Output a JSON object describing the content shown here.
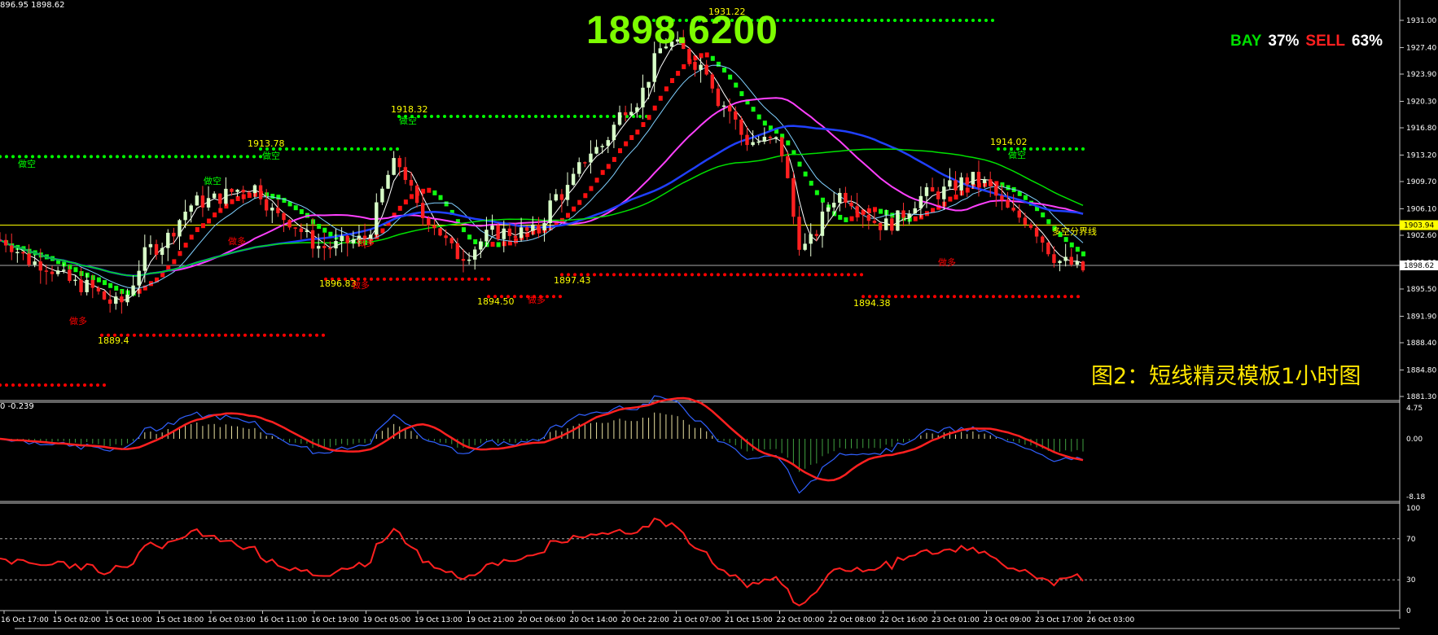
{
  "header": {
    "ohlc_text": "896.95 1898.62",
    "big_price": "1898.6200",
    "sentiment": {
      "buy_label": "BAY",
      "buy_pct": "37%",
      "sell_label": "SELL",
      "sell_pct": "63%"
    },
    "caption": "图2：短线精灵模板1小时图"
  },
  "colors": {
    "green": "#00FF00",
    "red": "#FF0000",
    "yellow": "#FFFF00",
    "buy": "#00E000",
    "sell": "#FF2020",
    "price_line": "#FFFF00"
  },
  "price_axis": {
    "labels": [
      "1931.00",
      "1927.40",
      "1923.90",
      "1920.30",
      "1916.80",
      "1913.20",
      "1909.70",
      "1906.10",
      "1902.60",
      "1899.00",
      "1895.50",
      "1891.90",
      "1888.40",
      "1884.80",
      "1881.30"
    ],
    "current_price": "1903.94",
    "bid_price": "1898.62"
  },
  "annotations": [
    {
      "text": "1931.22",
      "color": "yellow"
    },
    {
      "text": "1918.32",
      "color": "yellow"
    },
    {
      "text": "1913.78",
      "color": "yellow"
    },
    {
      "text": "1914.02",
      "color": "yellow"
    },
    {
      "text": "1896.83",
      "color": "yellow"
    },
    {
      "text": "1894.50",
      "color": "yellow"
    },
    {
      "text": "1897.43",
      "color": "yellow"
    },
    {
      "text": "1894.38",
      "color": "yellow"
    },
    {
      "text": "1889.4",
      "color": "yellow"
    },
    {
      "text": "做空",
      "color": "green"
    },
    {
      "text": "做多",
      "color": "red"
    },
    {
      "text": "做空",
      "color": "green"
    },
    {
      "text": "做多",
      "color": "red"
    },
    {
      "text": "做空",
      "color": "green"
    },
    {
      "text": "做多",
      "color": "red"
    },
    {
      "text": "做空",
      "color": "green"
    },
    {
      "text": "做多",
      "color": "red"
    },
    {
      "text": "做多",
      "color": "red"
    },
    {
      "text": "做空",
      "color": "green"
    },
    {
      "text": "做多",
      "color": "red"
    },
    {
      "text": "多空分界线",
      "color": "yellow"
    }
  ],
  "macd": {
    "label": "0 -0.239",
    "axis": [
      "4.75",
      "0.00",
      "-8.18"
    ]
  },
  "rsi": {
    "axis": [
      "100",
      "70",
      "30",
      "0"
    ]
  },
  "time_axis": [
    "16 Oct 17:00",
    "15 Oct 02:00",
    "15 Oct 10:00",
    "15 Oct 18:00",
    "16 Oct 03:00",
    "16 Oct 11:00",
    "16 Oct 19:00",
    "19 Oct 05:00",
    "19 Oct 13:00",
    "19 Oct 21:00",
    "20 Oct 06:00",
    "20 Oct 14:00",
    "20 Oct 22:00",
    "21 Oct 07:00",
    "21 Oct 15:00",
    "22 Oct 00:00",
    "22 Oct 08:00",
    "22 Oct 16:00",
    "23 Oct 01:00",
    "23 Oct 09:00",
    "23 Oct 17:00",
    "26 Oct 03:00"
  ]
}
